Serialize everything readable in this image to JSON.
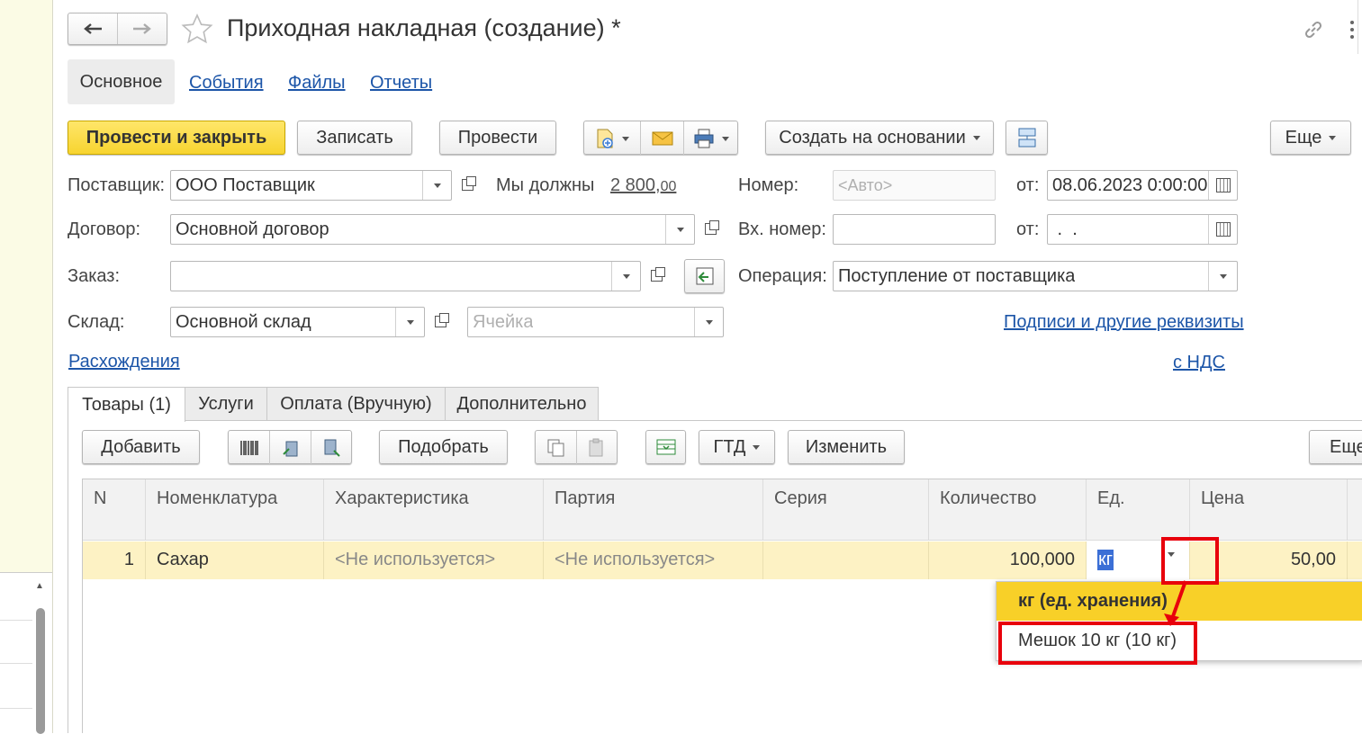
{
  "window": {
    "title": "Приходная накладная (создание) *",
    "back_icon": "arrow-left-icon",
    "forward_icon": "arrow-right-icon",
    "star_icon": "star-icon",
    "link_icon": "link-icon",
    "more_icon": "vertical-dots-icon"
  },
  "nav_tabs": [
    {
      "label": "Основное",
      "active": true
    },
    {
      "label": "События"
    },
    {
      "label": "Файлы"
    },
    {
      "label": "Отчеты"
    }
  ],
  "toolbar": {
    "post_close": "Провести и закрыть",
    "write": "Записать",
    "post": "Провести",
    "create_based": "Создать на основании",
    "more": "Еще"
  },
  "form": {
    "supplier_label": "Поставщик:",
    "supplier_value": "ООО Поставщик",
    "debt_label": "Мы должны",
    "debt_int": "2 800,",
    "debt_dec": "00",
    "number_label": "Номер:",
    "number_placeholder": "<Авто>",
    "date_from_label": "от:",
    "date_value": "08.06.2023  0:00:00",
    "contract_label": "Договор:",
    "contract_value": "Основной договор",
    "in_number_label": "Вх. номер:",
    "in_number_value": "",
    "in_date_label": "от:",
    "in_date_value": " .  .",
    "order_label": "Заказ:",
    "order_value": "",
    "operation_label": "Операция:",
    "operation_value": "Поступление от поставщика",
    "warehouse_label": "Склад:",
    "warehouse_value": "Основной склад",
    "cell_placeholder": "Ячейка",
    "signatures_link": "Подписи и другие реквизиты",
    "discrepancies_link": "Расхождения",
    "vat_link": "с НДС"
  },
  "page_tabs": [
    {
      "label": "Товары (1)",
      "active": true
    },
    {
      "label": "Услуги"
    },
    {
      "label": "Оплата (Вручную)"
    },
    {
      "label": "Дополнительно"
    }
  ],
  "table_toolbar": {
    "add": "Добавить",
    "pick": "Подобрать",
    "gtd": "ГТД",
    "change": "Изменить",
    "more": "Еще"
  },
  "table": {
    "columns": [
      "N",
      "Номенклатура",
      "Характеристика",
      "Партия",
      "Серия",
      "Количество",
      "Ед.",
      "Цена"
    ],
    "rows": [
      {
        "n": "1",
        "nomenclature": "Сахар",
        "characteristic": "<Не используется>",
        "batch": "<Не используется>",
        "series": "",
        "quantity": "100,000",
        "unit": "кг",
        "price": "50,00"
      }
    ]
  },
  "unit_dropdown": {
    "options": [
      "кг (ед. хранения)",
      "Мешок 10 кг (10 кг)"
    ],
    "selected_index": 0
  },
  "colors": {
    "accent_yellow": "#f7d42f",
    "row_highlight": "#fdf2c4",
    "link_blue": "#1c55a8",
    "annotation_red": "#e8000b"
  }
}
